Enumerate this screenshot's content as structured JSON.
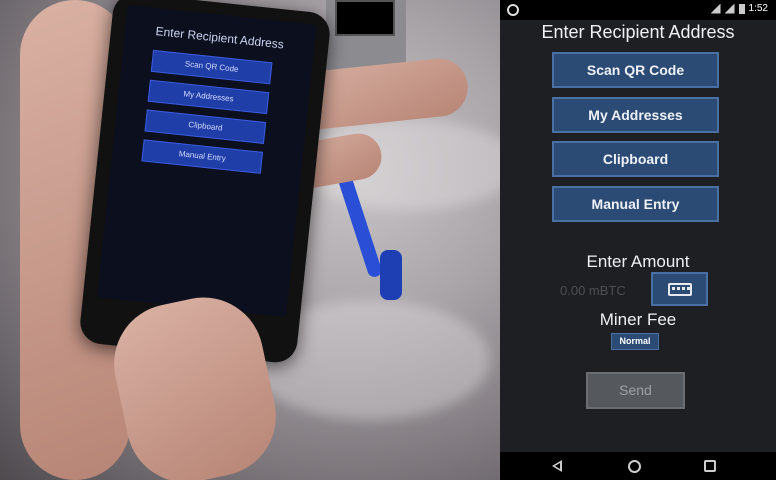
{
  "status_bar": {
    "time": "1:52"
  },
  "app": {
    "title": "Enter Recipient Address",
    "buttons": {
      "scan_qr": "Scan QR Code",
      "my_addresses": "My Addresses",
      "clipboard": "Clipboard",
      "manual_entry": "Manual Entry"
    },
    "amount_label": "Enter Amount",
    "amount_value": "0.00 mBTC",
    "miner_fee_label": "Miner Fee",
    "miner_fee_value": "Normal",
    "send_label": "Send"
  },
  "photo_phone": {
    "title": "Enter Recipient Address",
    "buttons": [
      "Scan QR Code",
      "My Addresses",
      "Clipboard",
      "Manual Entry"
    ]
  },
  "colors": {
    "button_fill": "#2b4a74",
    "button_border": "#4a6fa3",
    "background": "#1d1f22",
    "send_disabled": "#55585c"
  }
}
